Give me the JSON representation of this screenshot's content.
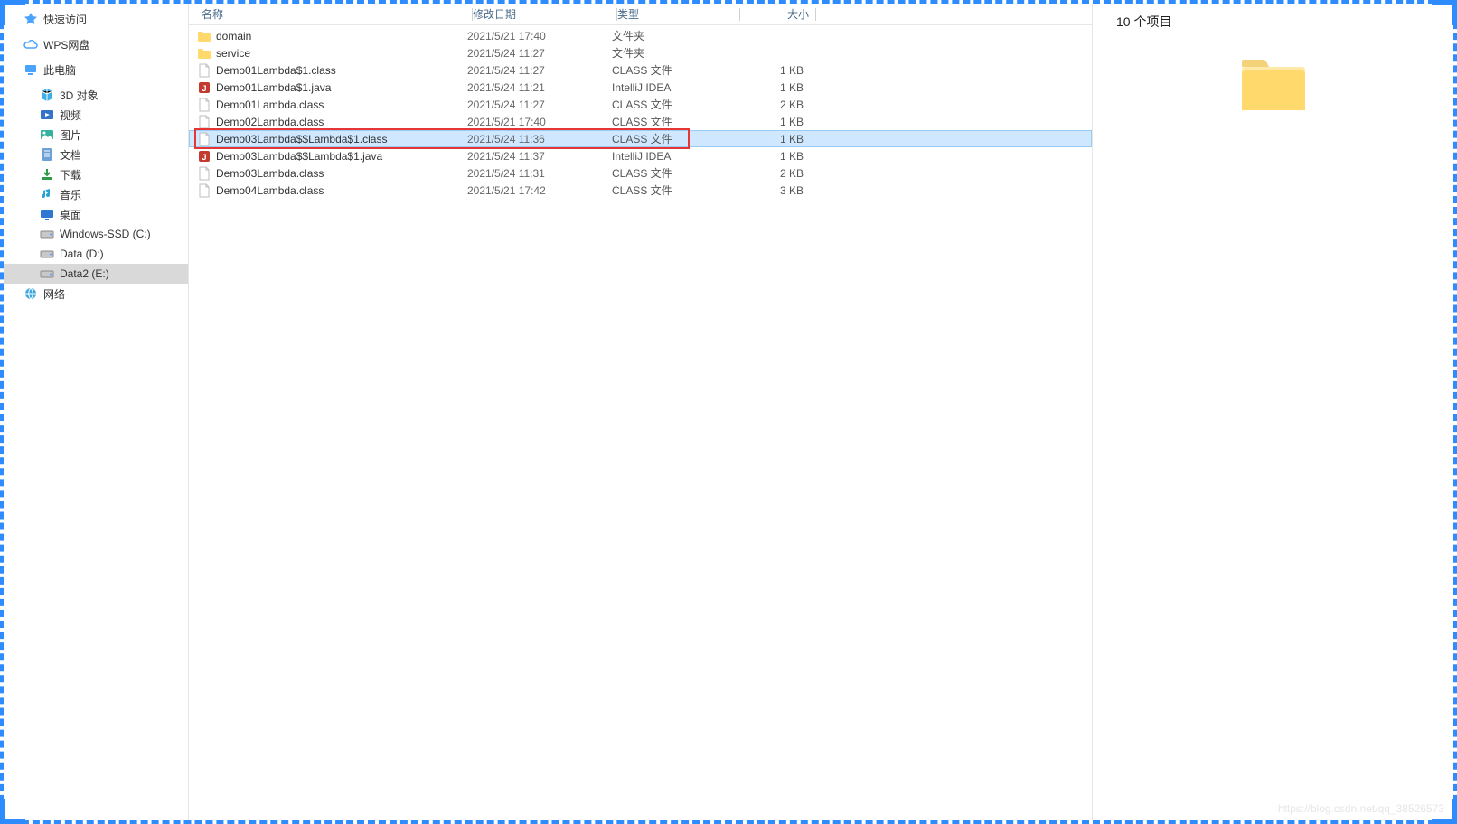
{
  "columns": {
    "name": "名称",
    "modified": "修改日期",
    "type": "类型",
    "size": "大小"
  },
  "preview": {
    "count": "10 个项目"
  },
  "watermark": "https://blog.csdn.net/qq_38526573",
  "sidebar": [
    {
      "kind": "top",
      "icon": "star",
      "label": "快速访问"
    },
    {
      "kind": "top",
      "icon": "cloud",
      "label": "WPS网盘"
    },
    {
      "kind": "top",
      "icon": "pc",
      "label": "此电脑"
    },
    {
      "kind": "child",
      "icon": "cube",
      "label": "3D 对象"
    },
    {
      "kind": "child",
      "icon": "video",
      "label": "视频"
    },
    {
      "kind": "child",
      "icon": "pic",
      "label": "图片"
    },
    {
      "kind": "child",
      "icon": "doc",
      "label": "文档"
    },
    {
      "kind": "child",
      "icon": "download",
      "label": "下载"
    },
    {
      "kind": "child",
      "icon": "music",
      "label": "音乐"
    },
    {
      "kind": "child",
      "icon": "desktop",
      "label": "桌面"
    },
    {
      "kind": "child",
      "icon": "drive",
      "label": "Windows-SSD (C:)"
    },
    {
      "kind": "child",
      "icon": "drive",
      "label": "Data (D:)"
    },
    {
      "kind": "child",
      "icon": "drive",
      "label": "Data2 (E:)",
      "selected": true
    },
    {
      "kind": "top",
      "icon": "net",
      "label": "网络"
    }
  ],
  "rows": [
    {
      "icon": "folder",
      "name": "domain",
      "mod": "2021/5/21 17:40",
      "type": "文件夹",
      "size": ""
    },
    {
      "icon": "folder",
      "name": "service",
      "mod": "2021/5/24 11:27",
      "type": "文件夹",
      "size": ""
    },
    {
      "icon": "file",
      "name": "Demo01Lambda$1.class",
      "mod": "2021/5/24 11:27",
      "type": "CLASS 文件",
      "size": "1 KB"
    },
    {
      "icon": "java",
      "name": "Demo01Lambda$1.java",
      "mod": "2021/5/24 11:21",
      "type": "IntelliJ IDEA",
      "size": "1 KB"
    },
    {
      "icon": "file",
      "name": "Demo01Lambda.class",
      "mod": "2021/5/24 11:27",
      "type": "CLASS 文件",
      "size": "2 KB"
    },
    {
      "icon": "file",
      "name": "Demo02Lambda.class",
      "mod": "2021/5/21 17:40",
      "type": "CLASS 文件",
      "size": "1 KB"
    },
    {
      "icon": "file",
      "name": "Demo03Lambda$$Lambda$1.class",
      "mod": "2021/5/24 11:36",
      "type": "CLASS 文件",
      "size": "1 KB",
      "selected": true,
      "boxed": true
    },
    {
      "icon": "java",
      "name": "Demo03Lambda$$Lambda$1.java",
      "mod": "2021/5/24 11:37",
      "type": "IntelliJ IDEA",
      "size": "1 KB"
    },
    {
      "icon": "file",
      "name": "Demo03Lambda.class",
      "mod": "2021/5/24 11:31",
      "type": "CLASS 文件",
      "size": "2 KB"
    },
    {
      "icon": "file",
      "name": "Demo04Lambda.class",
      "mod": "2021/5/21 17:42",
      "type": "CLASS 文件",
      "size": "3 KB"
    }
  ]
}
